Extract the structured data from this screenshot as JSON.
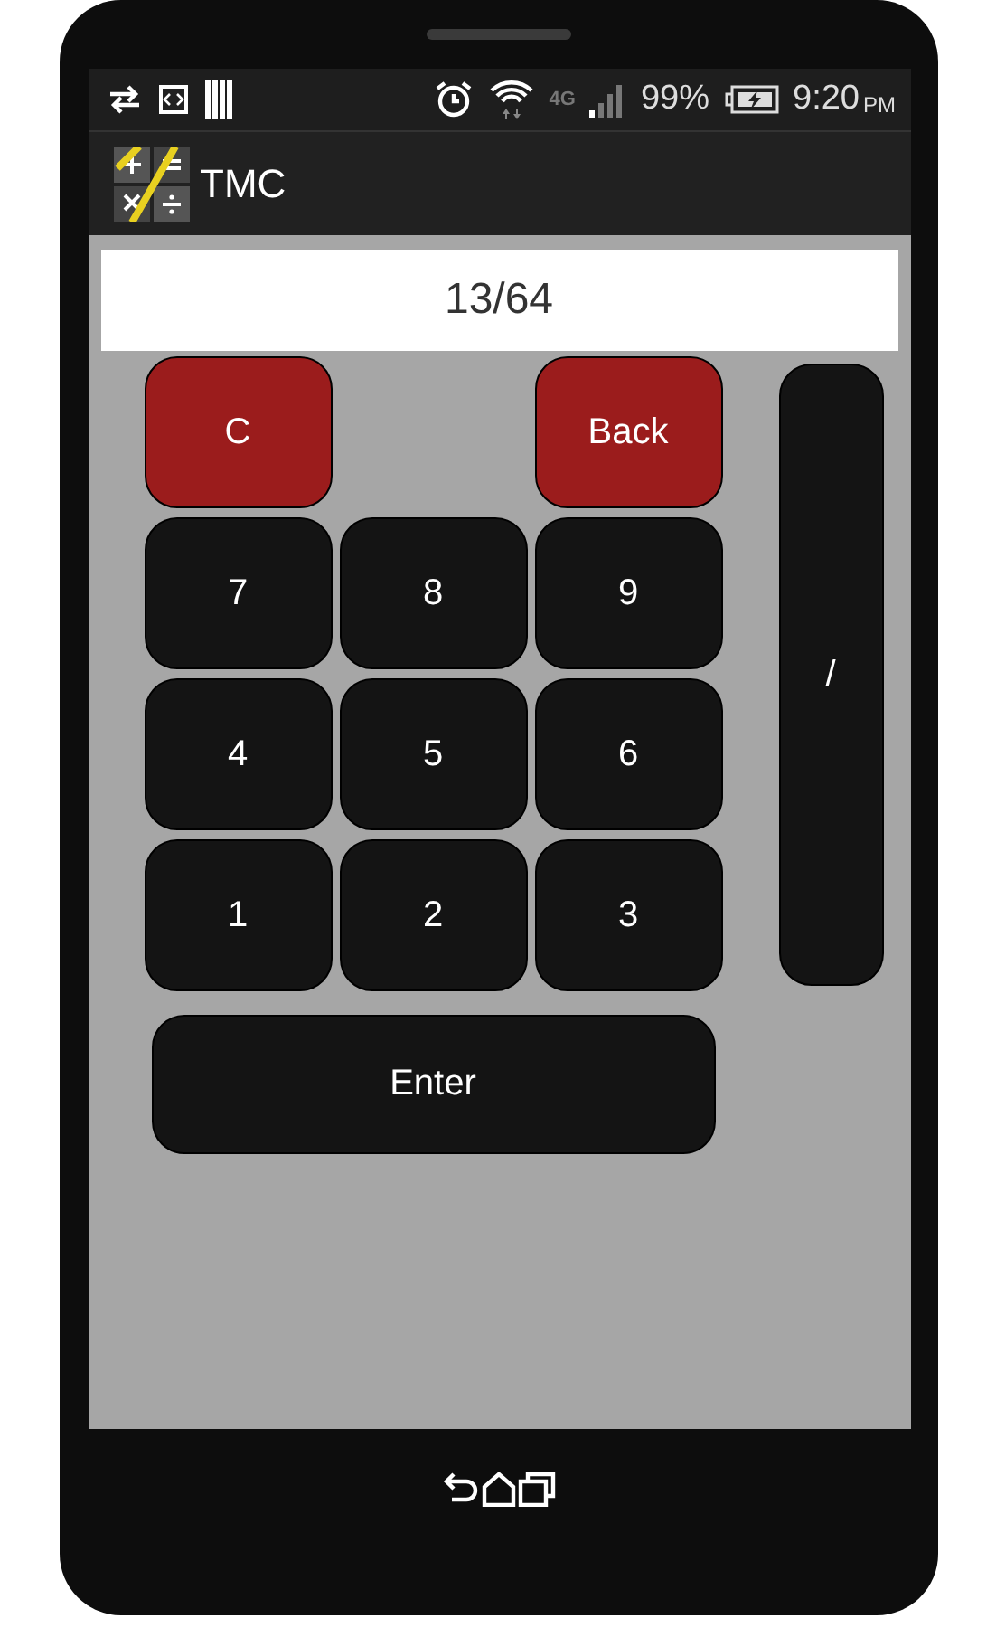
{
  "status_bar": {
    "network": "4G",
    "battery": "99%",
    "time": "9:20",
    "period": "PM"
  },
  "app_bar": {
    "title": "TMC"
  },
  "display": {
    "value": "13/64"
  },
  "top_keys": [
    {
      "label": "C",
      "kind": "danger"
    },
    {
      "label": "Back",
      "kind": "danger"
    }
  ],
  "digit_rows": [
    [
      "7",
      "8",
      "9"
    ],
    [
      "4",
      "5",
      "6"
    ],
    [
      "1",
      "2",
      "3"
    ]
  ],
  "operator_key": {
    "label": "/"
  },
  "enter_key": {
    "label": "Enter"
  }
}
